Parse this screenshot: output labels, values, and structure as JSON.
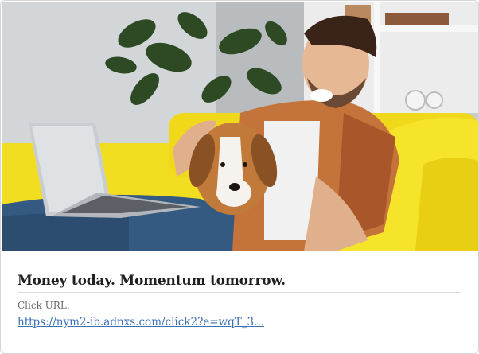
{
  "ad": {
    "headline": "Money today. Momentum tomorrow.",
    "click_url_label": "Click URL:",
    "click_url": "https://nym2-ib.adnxs.com/click2?e=wqT_3..."
  },
  "colors": {
    "link": "#3b6fb6",
    "sofa": "#f2de21",
    "wall": "#c9cdcf"
  }
}
